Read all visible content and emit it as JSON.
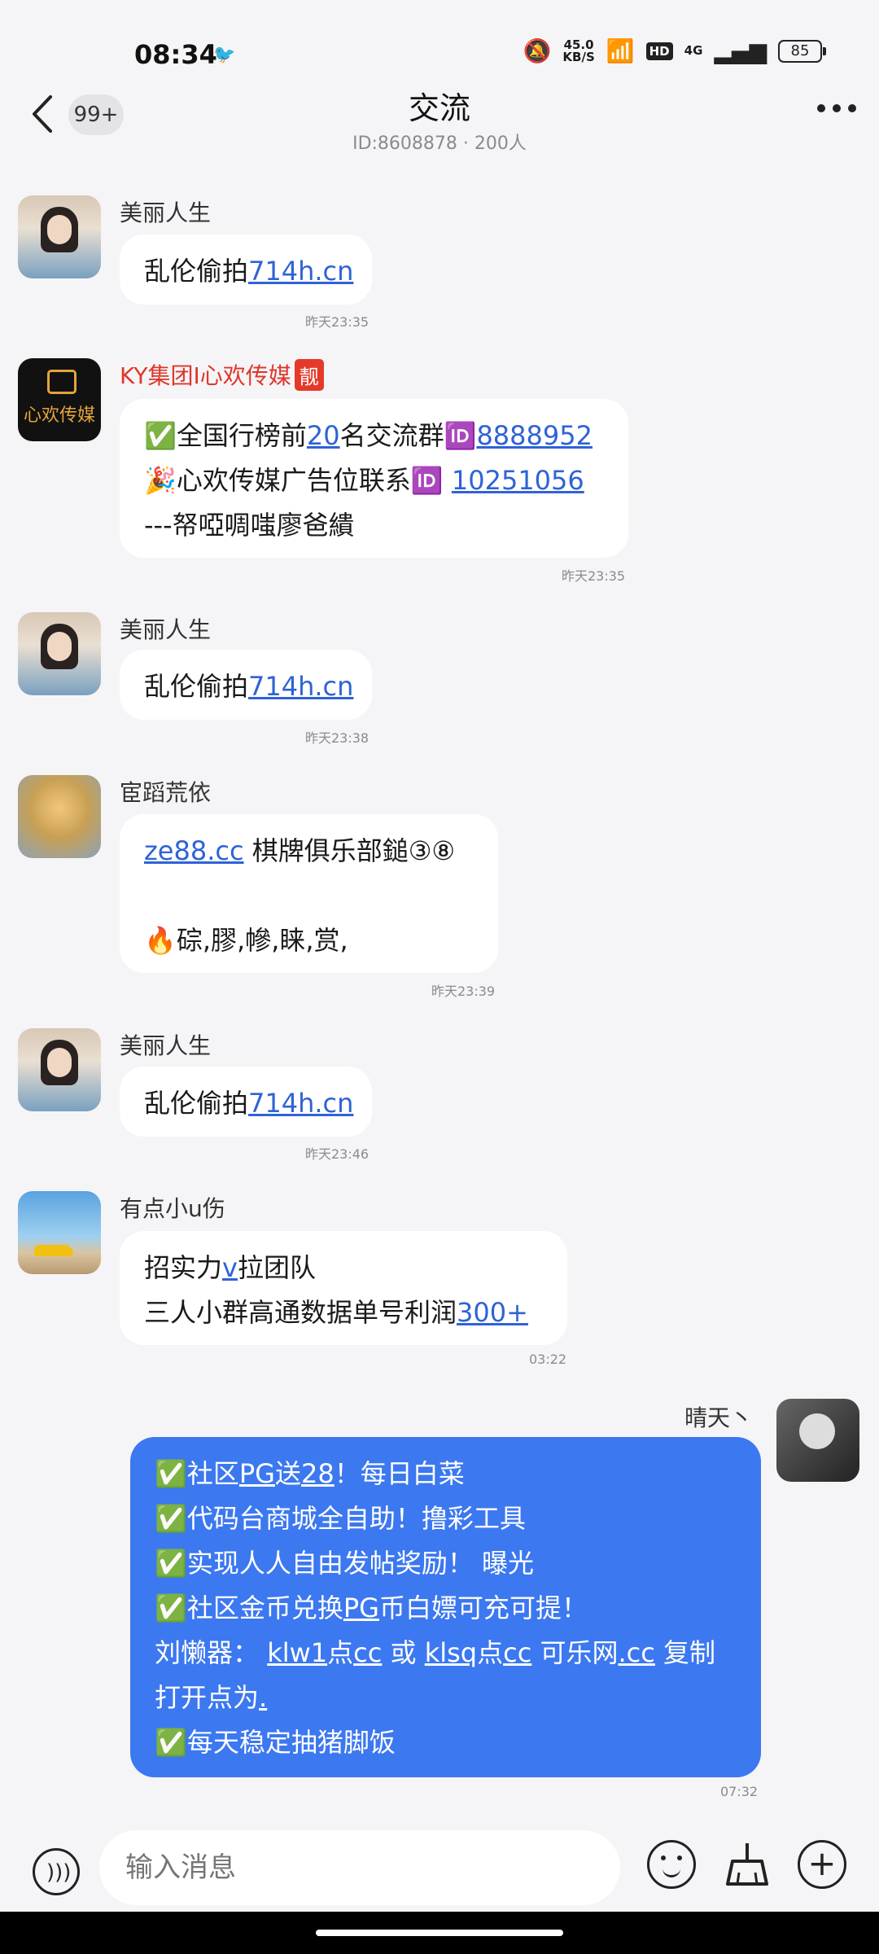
{
  "status": {
    "time": "08:34",
    "network_speed": "45.0",
    "network_unit": "KB/S",
    "hd": "HD",
    "signal": "4G",
    "battery": "85"
  },
  "header": {
    "unread_badge": "99+",
    "title": "交流",
    "subtitle": "ID:8608878 · 200人"
  },
  "messages": [
    {
      "sender": "美丽人生",
      "lines": [
        [
          "乱伦偷拍",
          "714h.cn"
        ]
      ],
      "time": "昨天23:35"
    },
    {
      "sender": "KY集团I心欢传媒",
      "badge": "靓",
      "avatar_text": "心欢传媒",
      "lines": [
        [
          "✅全国行榜前",
          "20",
          "名交流群🆔",
          "8888952"
        ],
        [
          "🎉心欢传媒广告位联系🆔 ",
          "10251056"
        ],
        [
          "---帑啞啁嗤廖爸繢"
        ]
      ],
      "time": "昨天23:35"
    },
    {
      "sender": "美丽人生",
      "lines": [
        [
          "乱伦偷拍",
          "714h.cn"
        ]
      ],
      "time": "昨天23:38"
    },
    {
      "sender": "宦蹈荒依",
      "lines": [
        [
          "ze88.cc",
          "  棋牌俱乐部鎚③⑧"
        ],
        [
          ""
        ],
        [
          "🔥碂,膠,幓,睐,赏,"
        ]
      ],
      "time": "昨天23:39"
    },
    {
      "sender": "美丽人生",
      "lines": [
        [
          "乱伦偷拍",
          "714h.cn"
        ]
      ],
      "time": "昨天23:46"
    },
    {
      "sender": "有点小u伤",
      "lines": [
        [
          "招实力",
          "v",
          "拉团队"
        ],
        [
          "三人小群高通数据单号利润",
          "300+"
        ]
      ],
      "time": "03:22"
    },
    {
      "sender": "晴天丶",
      "mine": true,
      "lines": [
        [
          "✅社区",
          "PG",
          "送",
          "28",
          "！每日白菜"
        ],
        [
          "✅代码台商城全自助！撸彩工具"
        ],
        [
          "✅实现人人自由发帖奖励！ 曝光"
        ],
        [
          "✅社区金币兑换",
          "PG",
          "币白嫖可充可提！"
        ],
        [
          "刘懒器： ",
          "klw1",
          "点",
          "cc",
          " 或 ",
          "klsq",
          "点",
          "cc",
          " 可乐网",
          ".cc",
          "  复制"
        ],
        [
          "打开点为",
          "."
        ],
        [
          "✅每天稳定抽猪脚饭"
        ]
      ],
      "time": "07:32"
    }
  ],
  "input": {
    "placeholder": "输入消息"
  },
  "icons": {
    "back": "chevron-left-icon",
    "more": "more-dots-icon",
    "voice": "voice-icon",
    "emoji": "emoji-icon",
    "clean": "broom-icon",
    "add": "plus-icon"
  }
}
